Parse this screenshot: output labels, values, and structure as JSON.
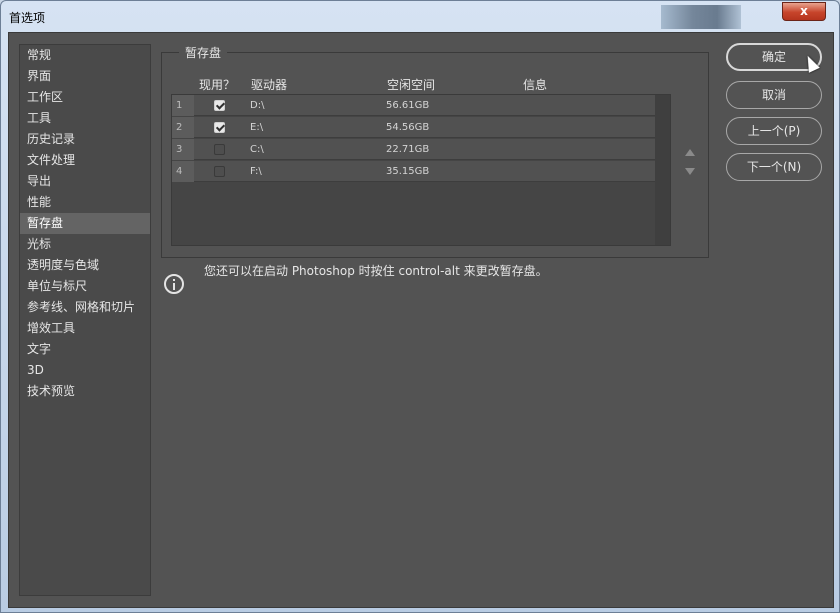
{
  "window": {
    "title": "首选项",
    "close_label": "x"
  },
  "sidebar": {
    "items": [
      {
        "label": "常规"
      },
      {
        "label": "界面"
      },
      {
        "label": "工作区"
      },
      {
        "label": "工具"
      },
      {
        "label": "历史记录"
      },
      {
        "label": "文件处理"
      },
      {
        "label": "导出"
      },
      {
        "label": "性能"
      },
      {
        "label": "暂存盘",
        "active": true
      },
      {
        "label": "光标"
      },
      {
        "label": "透明度与色域"
      },
      {
        "label": "单位与标尺"
      },
      {
        "label": "参考线、网格和切片"
      },
      {
        "label": "增效工具"
      },
      {
        "label": "文字"
      },
      {
        "label": "3D"
      },
      {
        "label": "技术预览"
      }
    ]
  },
  "scratch": {
    "group_title": "暂存盘",
    "headers": {
      "active": "现用？",
      "drive": "驱动器",
      "free": "空闲空间",
      "info": "信息"
    },
    "rows": [
      {
        "num": "1",
        "checked": true,
        "drive": "D:\\",
        "free": "56.61GB",
        "info": ""
      },
      {
        "num": "2",
        "checked": true,
        "drive": "E:\\",
        "free": "54.56GB",
        "info": ""
      },
      {
        "num": "3",
        "checked": false,
        "drive": "C:\\",
        "free": "22.71GB",
        "info": ""
      },
      {
        "num": "4",
        "checked": false,
        "drive": "F:\\",
        "free": "35.15GB",
        "info": ""
      }
    ]
  },
  "info_text": "您还可以在启动 Photoshop 时按住 control-alt 来更改暂存盘。",
  "buttons": {
    "ok": "确定",
    "cancel": "取消",
    "prev": "上一个(P)",
    "next": "下一个(N)"
  }
}
